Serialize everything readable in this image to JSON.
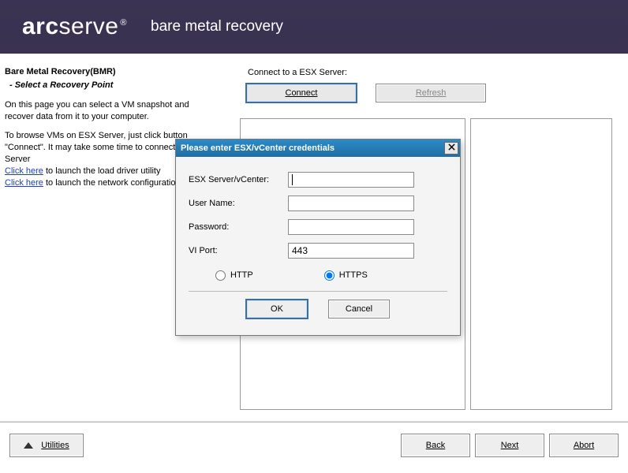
{
  "banner": {
    "brand_bold": "arc",
    "brand_rest": "serve",
    "registered": "®",
    "subtitle": "bare metal recovery"
  },
  "left": {
    "title": "Bare Metal Recovery(BMR)",
    "subtitle": "- Select a Recovery Point",
    "para1": "On this page you can select a VM snapshot and recover data from it to your computer.",
    "para2a": "To browse VMs on ESX Server, just click button \"Connect\". It may take some time to connect to ESX Server",
    "link_text": "Click here",
    "link1_after": " to launch the load driver utility",
    "link2_after": " to launch the network configuration utility"
  },
  "right": {
    "connect_label": "Connect to a ESX Server:",
    "connect_btn": "Connect",
    "refresh_btn": "Refresh"
  },
  "bottom": {
    "utilities": "Utilities",
    "back": "Back",
    "next": "Next",
    "abort": "Abort"
  },
  "dialog": {
    "title": "Please enter ESX/vCenter credentials",
    "close_x": "X",
    "esx_label": "ESX Server/vCenter:",
    "user_label": "User Name:",
    "pass_label": "Password:",
    "port_label": "VI Port:",
    "esx_value": "",
    "user_value": "",
    "pass_value": "",
    "port_value": "443",
    "http_label": "HTTP",
    "https_label": "HTTPS",
    "ok": "OK",
    "cancel": "Cancel"
  }
}
